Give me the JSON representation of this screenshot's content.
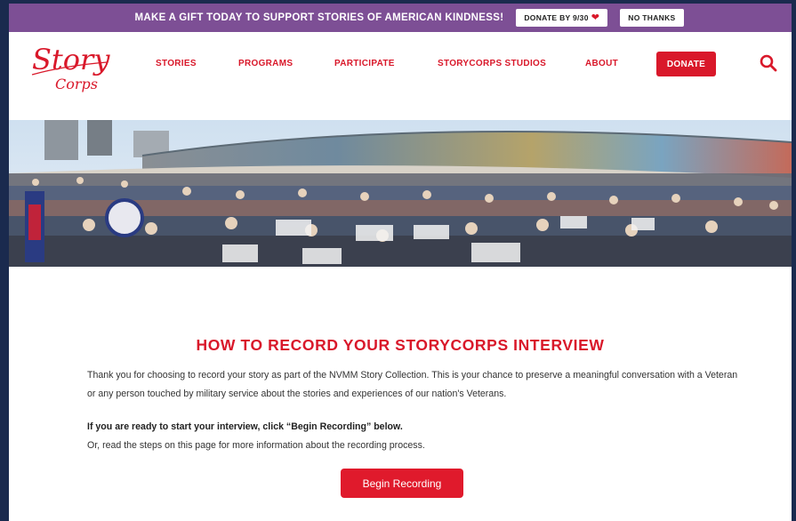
{
  "promo": {
    "text": "MAKE A GIFT TODAY TO SUPPORT STORIES OF AMERICAN KINDNESS!",
    "donate_label": "DONATE BY 9/30",
    "no_thanks_label": "NO THANKS",
    "bg_color": "#7d4f95"
  },
  "header": {
    "logo_line1": "Story",
    "logo_line2": "Corps",
    "nav": [
      {
        "label": "STORIES"
      },
      {
        "label": "PROGRAMS"
      },
      {
        "label": "PARTICIPATE"
      },
      {
        "label": "STORYCORPS STUDIOS"
      },
      {
        "label": "ABOUT"
      }
    ],
    "donate_label": "DONATE",
    "accent_color": "#d9182a",
    "search_icon": "search-icon"
  },
  "main": {
    "title": "HOW TO RECORD YOUR STORYCORPS INTERVIEW",
    "intro": "Thank you for choosing to record your story as part of the NVMM Story Collection. This is your chance to preserve a meaningful conversation with a Veteran or any person touched by military service about the stories and experiences of our nation's Veterans.",
    "ready_text": "If you are ready to start your interview, click “Begin Recording” below.",
    "read_text": "Or, read the steps on this page for more information about the recording process.",
    "begin_label": "Begin Recording"
  }
}
